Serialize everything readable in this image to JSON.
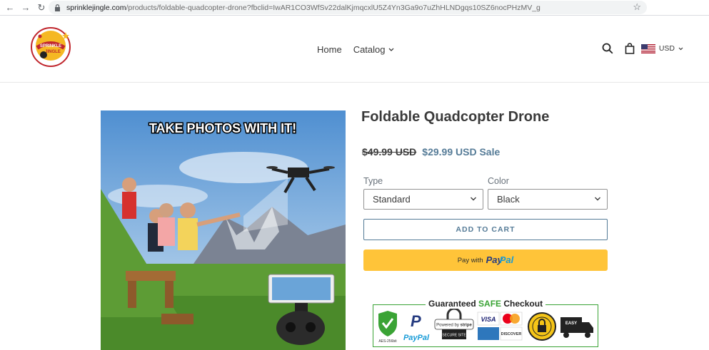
{
  "browser": {
    "url_domain": "sprinklejingle.com",
    "url_path": "/products/foldable-quadcopter-drone?fbclid=IwAR1CO3WfSv22dalKjmqcxlU5Z4Yn3Ga9o7uZhHLNDgqs10SZ6nocPHzMV_g"
  },
  "header": {
    "logo_text": "SPRINKLE JINGLE",
    "nav": [
      {
        "label": "Home"
      },
      {
        "label": "Catalog"
      }
    ],
    "currency": "USD"
  },
  "product": {
    "image_caption": "TAKE PHOTOS WITH IT!",
    "title": "Foldable Quadcopter Drone",
    "price_old": "$49.99 USD",
    "price_new": "$29.99 USD",
    "sale_label": "Sale",
    "options": [
      {
        "label": "Type",
        "value": "Standard"
      },
      {
        "label": "Color",
        "value": "Black"
      }
    ],
    "add_to_cart": "ADD TO CART",
    "paypal": {
      "pay_with": "Pay with",
      "brand_1": "Pay",
      "brand_2": "Pal"
    }
  },
  "trust": {
    "title_1": "Guaranteed",
    "title_2": "SAFE",
    "title_3": "Checkout",
    "badge_aes": "AES-256bit",
    "badge_paypal": "PayPal",
    "badge_stripe_1": "Powered by",
    "badge_stripe_2": "stripe",
    "badge_stripe_3": "SECURE SITE",
    "badge_visa": "VISA",
    "badge_discover": "DISCOVER",
    "badge_easy": "EASY"
  },
  "colors": {
    "accent": "#557b97",
    "paypal_yellow": "#ffc439",
    "trust_green": "#3aa335"
  }
}
